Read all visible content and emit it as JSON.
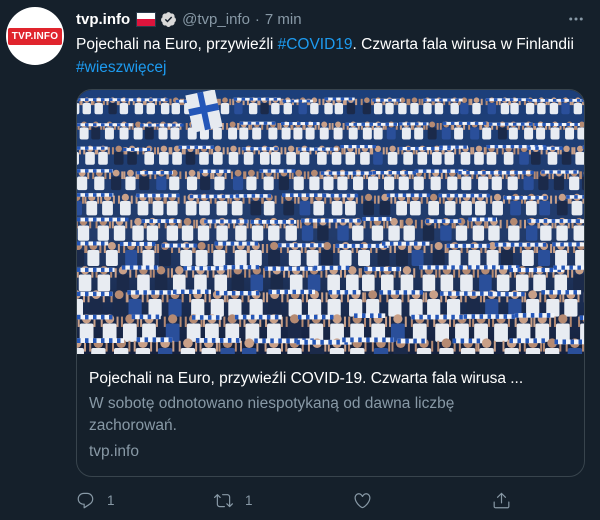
{
  "tweet": {
    "avatar_text": "TVP.INFO",
    "display_name": "tvp.info",
    "handle": "@tvp_info",
    "separator": "·",
    "time": "7 min",
    "text_part1": "Pojechali na Euro, przywieźli ",
    "hashtag1": "#COVID19",
    "text_part2": ". Czwarta fala wirusa w Finlandii ",
    "hashtag2": "#wieszwięcej"
  },
  "card": {
    "image_alt": "Finnish football fans in white and blue holding scarves in a stadium",
    "title": "Pojechali na Euro, przywieźli COVID-19. Czwarta fala wirusa ...",
    "description": "W sobotę odnotowano niespotykaną od dawna liczbę zachorowań.",
    "domain": "tvp.info"
  },
  "actions": {
    "reply_count": "1",
    "retweet_count": "1",
    "like_count": ""
  },
  "colors": {
    "background": "#15202b",
    "accent": "#1d9bf0",
    "muted": "#8899a6",
    "border": "#38444d",
    "brand": "#e0242d"
  },
  "icons": [
    "verified-badge-icon",
    "more-options-icon",
    "reply-icon",
    "retweet-icon",
    "like-icon",
    "share-icon"
  ]
}
